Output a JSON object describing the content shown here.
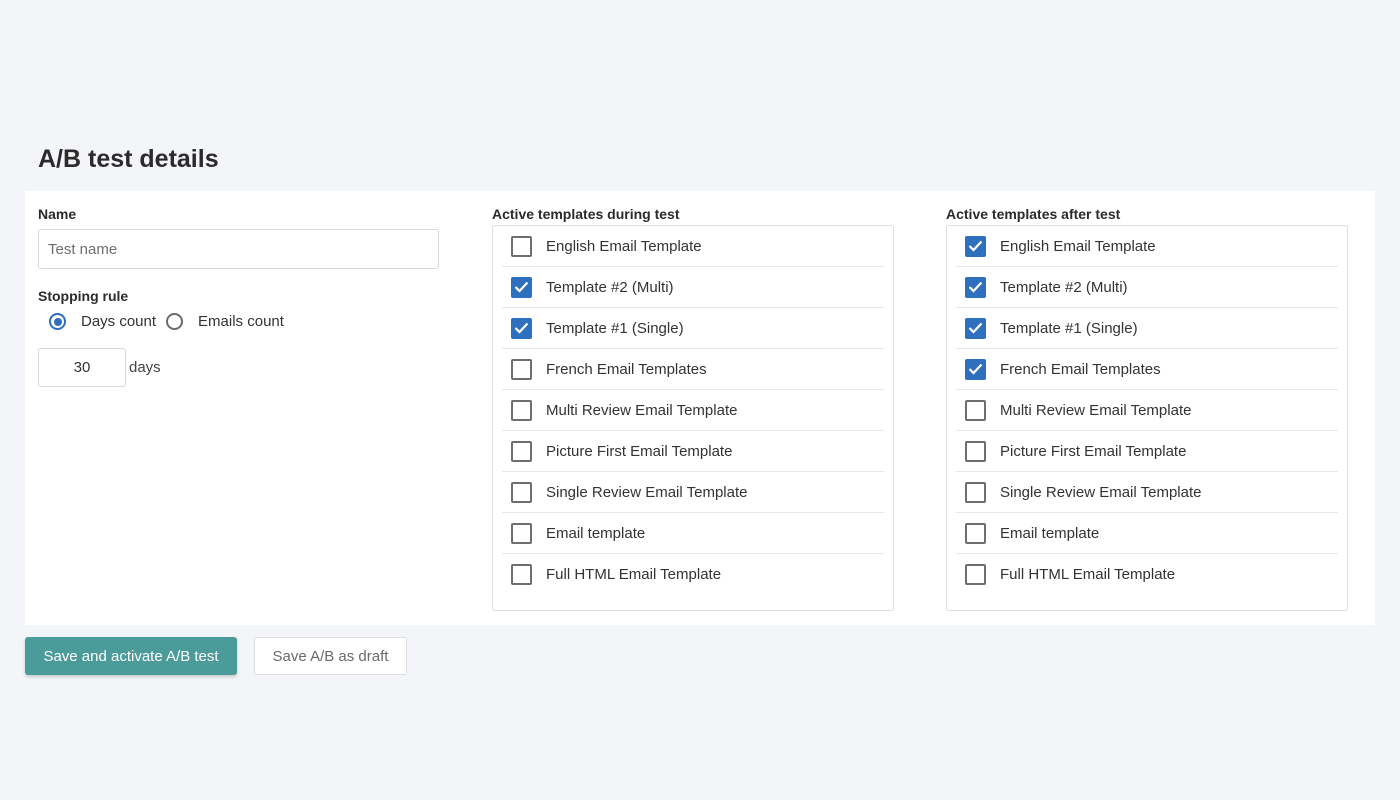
{
  "page": {
    "title": "A/B test details"
  },
  "form": {
    "name_label": "Name",
    "name_placeholder": "Test name",
    "name_value": "",
    "stopping_rule_label": "Stopping rule",
    "stopping_options": [
      {
        "label": "Days count",
        "selected": true
      },
      {
        "label": "Emails count",
        "selected": false
      }
    ],
    "days_value": "30",
    "days_unit": "days"
  },
  "during": {
    "label": "Active templates during test",
    "items": [
      {
        "label": "English Email Template",
        "checked": false
      },
      {
        "label": "Template #2 (Multi)",
        "checked": true
      },
      {
        "label": "Template #1 (Single)",
        "checked": true
      },
      {
        "label": "French Email Templates",
        "checked": false
      },
      {
        "label": "Multi Review Email Template",
        "checked": false
      },
      {
        "label": "Picture First Email Template",
        "checked": false
      },
      {
        "label": "Single Review Email Template",
        "checked": false
      },
      {
        "label": "Email template",
        "checked": false
      },
      {
        "label": "Full HTML Email Template",
        "checked": false
      }
    ]
  },
  "after": {
    "label": "Active templates after test",
    "items": [
      {
        "label": "English Email Template",
        "checked": true
      },
      {
        "label": "Template #2 (Multi)",
        "checked": true
      },
      {
        "label": "Template #1 (Single)",
        "checked": true
      },
      {
        "label": "French Email Templates",
        "checked": true
      },
      {
        "label": "Multi Review Email Template",
        "checked": false
      },
      {
        "label": "Picture First Email Template",
        "checked": false
      },
      {
        "label": "Single Review Email Template",
        "checked": false
      },
      {
        "label": "Email template",
        "checked": false
      },
      {
        "label": "Full HTML Email Template",
        "checked": false
      }
    ]
  },
  "actions": {
    "save_activate_label": "Save and activate A/B test",
    "save_draft_label": "Save A/B as draft"
  },
  "colors": {
    "accent_blue": "#2e6fbe",
    "primary_button": "#4b9b9a",
    "background": "#f4f5f8"
  }
}
